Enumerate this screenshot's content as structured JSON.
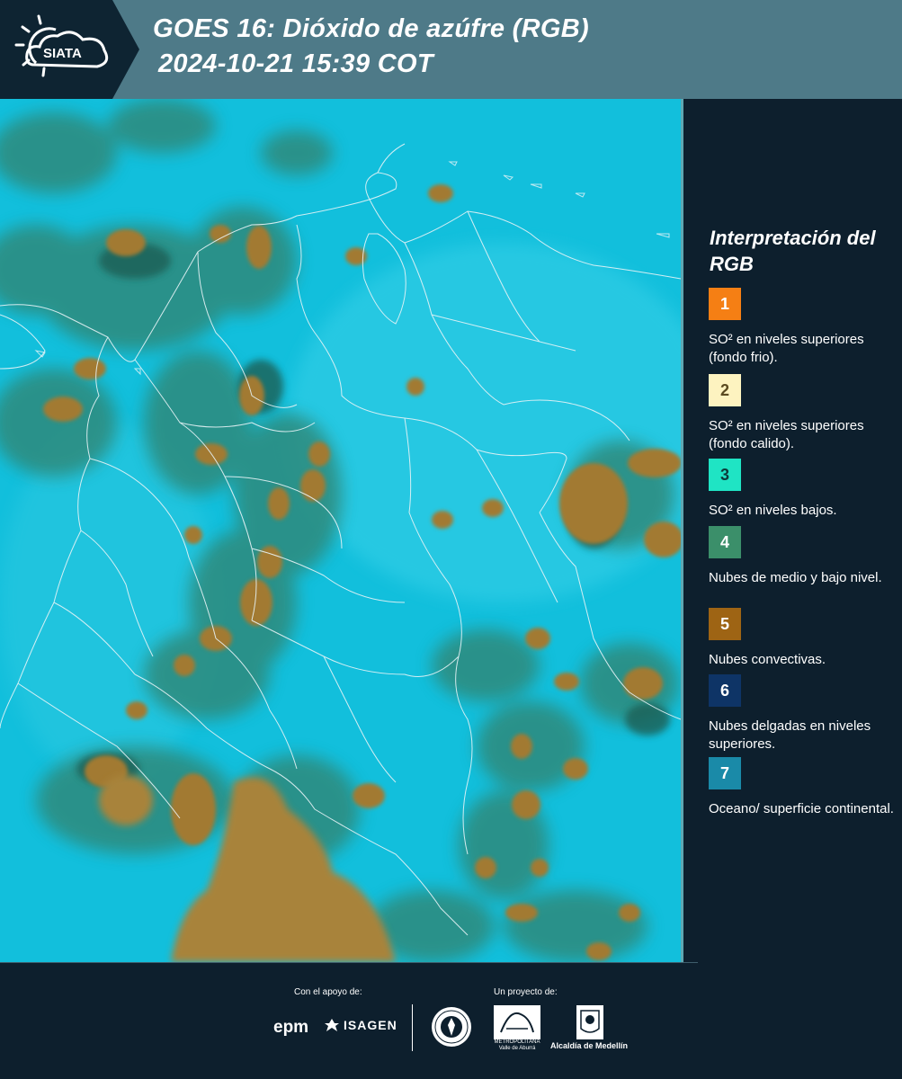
{
  "header": {
    "logo_text": "SIATA",
    "title_line1": "GOES 16: Dióxido de azúfre (RGB)",
    "title_line2": "2024-10-21 15:39 COT",
    "background_color": "#4e7a88"
  },
  "map": {
    "ocean_color": "#12bfdc",
    "low_cloud_color": "#2f8a7c",
    "convective_color": "#a27a30",
    "border_color": "#e8f4f7"
  },
  "legend": {
    "title": "Interpretación del RGB",
    "items": [
      {
        "number": "1",
        "color": "#f57f14",
        "num_color": "#ffffff",
        "text": "SO² en niveles superiores (fondo frio)."
      },
      {
        "number": "2",
        "color": "#fdf3c0",
        "num_color": "#5a4a20",
        "text": "SO² en niveles superiores (fondo calido)."
      },
      {
        "number": "3",
        "color": "#1fe4c4",
        "num_color": "#0d3a3a",
        "text": "SO² en niveles bajos."
      },
      {
        "number": "4",
        "color": "#3b8f6a",
        "num_color": "#ffffff",
        "text": "Nubes de medio y bajo nivel."
      },
      {
        "number": "5",
        "color": "#9e6414",
        "num_color": "#ffffff",
        "text": "Nubes convectivas."
      },
      {
        "number": "6",
        "color": "#0e3466",
        "num_color": "#ffffff",
        "text": "Nubes delgadas en niveles superiores."
      },
      {
        "number": "7",
        "color": "#1a8aa8",
        "num_color": "#ffffff",
        "text": "Oceano/ superficie continental."
      }
    ]
  },
  "footer": {
    "support_label": "Con el apoyo de:",
    "project_label": "Un proyecto de:",
    "epm": "epm",
    "isagen": "ISAGEN",
    "area_caption": "METROPOLITANA Valle de Aburrá",
    "alcaldia": "Alcaldía de Medellín"
  }
}
